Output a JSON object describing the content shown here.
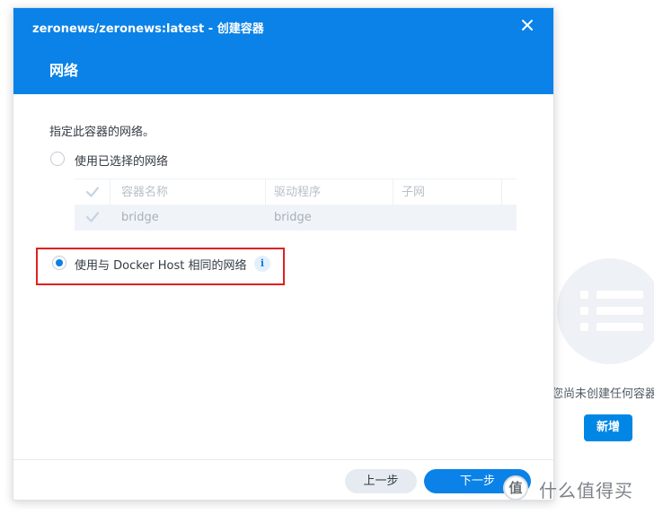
{
  "background": {
    "empty_text": "您尚未创建任何容器",
    "new_button_label": "新增"
  },
  "dialog": {
    "title": "zeronews/zeronews:latest - 创建容器",
    "step_title": "网络",
    "instruction": "指定此容器的网络。",
    "options": [
      {
        "label": "使用已选择的网络",
        "selected": false
      },
      {
        "label": "使用与 Docker Host 相同的网络",
        "selected": true
      }
    ],
    "table": {
      "columns": [
        "容器名称",
        "驱动程序",
        "子网"
      ],
      "rows": [
        {
          "name": "bridge",
          "driver": "bridge",
          "subnet": ""
        }
      ]
    },
    "buttons": {
      "prev": "上一步",
      "next": "下一步"
    }
  },
  "watermark": {
    "badge": "值",
    "text": "什么值得买"
  },
  "colors": {
    "accent": "#0a82e8",
    "highlight": "#e02020"
  }
}
